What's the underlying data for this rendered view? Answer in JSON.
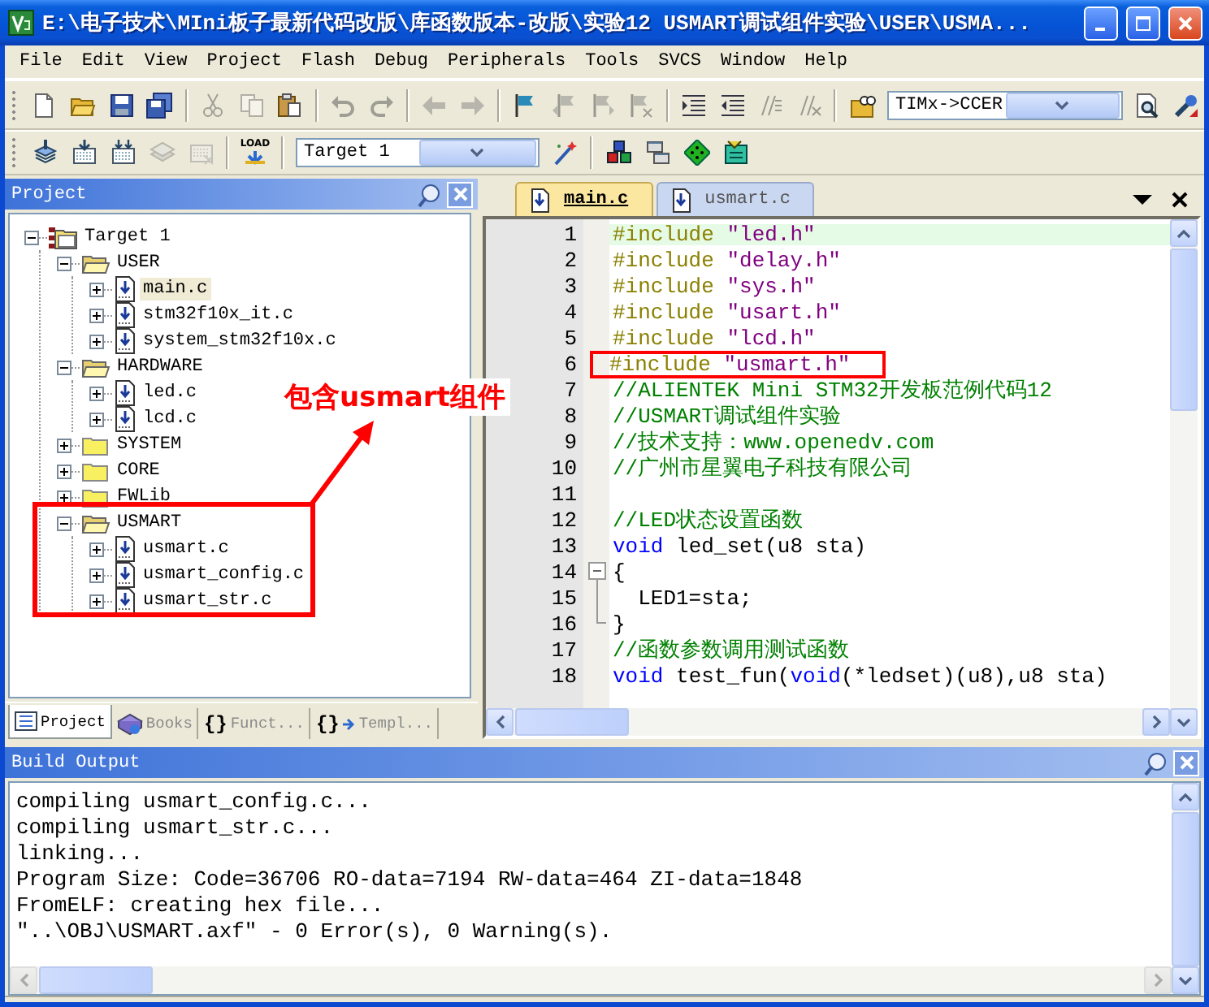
{
  "window": {
    "title": "E:\\电子技术\\MIni板子最新代码改版\\库函数版本-改版\\实验12 USMART调试组件实验\\USER\\USMA..."
  },
  "menu": [
    "File",
    "Edit",
    "View",
    "Project",
    "Flash",
    "Debug",
    "Peripherals",
    "Tools",
    "SVCS",
    "Window",
    "Help"
  ],
  "toolbar_1": [
    {
      "kind": "new",
      "disabled": false
    },
    {
      "kind": "open",
      "disabled": false
    },
    {
      "kind": "save",
      "disabled": false
    },
    {
      "kind": "save-all",
      "disabled": false
    },
    {
      "kind": "separator"
    },
    {
      "kind": "cut",
      "disabled": true
    },
    {
      "kind": "copy",
      "disabled": true
    },
    {
      "kind": "paste",
      "disabled": false
    },
    {
      "kind": "separator"
    },
    {
      "kind": "undo",
      "disabled": true
    },
    {
      "kind": "redo",
      "disabled": true
    },
    {
      "kind": "separator"
    },
    {
      "kind": "back",
      "disabled": true
    },
    {
      "kind": "forward",
      "disabled": true
    },
    {
      "kind": "separator"
    },
    {
      "kind": "bookmark",
      "disabled": false
    },
    {
      "kind": "bookmark-prev",
      "disabled": true
    },
    {
      "kind": "bookmark-next",
      "disabled": true
    },
    {
      "kind": "bookmark-clear",
      "disabled": true
    },
    {
      "kind": "separator"
    },
    {
      "kind": "indent",
      "disabled": false
    },
    {
      "kind": "unindent",
      "disabled": false
    },
    {
      "kind": "comment",
      "disabled": true
    },
    {
      "kind": "uncomment",
      "disabled": true
    },
    {
      "kind": "separator"
    },
    {
      "kind": "find-files",
      "disabled": false
    },
    {
      "kind": "combo",
      "value": "TIMx->CCER"
    },
    {
      "kind": "find",
      "disabled": false
    },
    {
      "kind": "debug",
      "disabled": false
    }
  ],
  "toolbar_2": [
    {
      "kind": "translate",
      "disabled": false
    },
    {
      "kind": "build",
      "disabled": false
    },
    {
      "kind": "rebuild",
      "disabled": false
    },
    {
      "kind": "batch",
      "disabled": true
    },
    {
      "kind": "stop",
      "disabled": true
    },
    {
      "kind": "separator"
    },
    {
      "kind": "load",
      "label": "LOAD",
      "disabled": false
    },
    {
      "kind": "separator"
    },
    {
      "kind": "combo",
      "value": "Target 1"
    },
    {
      "kind": "wand",
      "disabled": false
    },
    {
      "kind": "separator"
    },
    {
      "kind": "blocks",
      "disabled": false
    },
    {
      "kind": "windows",
      "disabled": false
    },
    {
      "kind": "diamond",
      "disabled": false
    },
    {
      "kind": "chip",
      "disabled": false
    }
  ],
  "project_panel": {
    "title": "Project",
    "tree": [
      {
        "label": "Target 1",
        "kind": "target",
        "expanded": true,
        "selected": false,
        "children": [
          {
            "label": "USER",
            "kind": "group",
            "expanded": true,
            "selected": false,
            "children": [
              {
                "label": "main.c",
                "kind": "file",
                "expanded": false,
                "selected": true
              },
              {
                "label": "stm32f10x_it.c",
                "kind": "file",
                "expanded": false,
                "selected": false
              },
              {
                "label": "system_stm32f10x.c",
                "kind": "file",
                "expanded": false,
                "selected": false
              }
            ]
          },
          {
            "label": "HARDWARE",
            "kind": "group",
            "expanded": true,
            "selected": false,
            "children": [
              {
                "label": "led.c",
                "kind": "file",
                "expanded": false,
                "selected": false
              },
              {
                "label": "lcd.c",
                "kind": "file",
                "expanded": false,
                "selected": false
              }
            ]
          },
          {
            "label": "SYSTEM",
            "kind": "group",
            "expanded": false,
            "selected": false
          },
          {
            "label": "CORE",
            "kind": "group",
            "expanded": false,
            "selected": false
          },
          {
            "label": "FWLib",
            "kind": "group",
            "expanded": false,
            "selected": false
          },
          {
            "label": "USMART",
            "kind": "group",
            "expanded": true,
            "selected": false,
            "children": [
              {
                "label": "usmart.c",
                "kind": "file",
                "expanded": false,
                "selected": false
              },
              {
                "label": "usmart_config.c",
                "kind": "file",
                "expanded": false,
                "selected": false
              },
              {
                "label": "usmart_str.c",
                "kind": "file",
                "expanded": false,
                "selected": false
              }
            ]
          }
        ]
      }
    ],
    "tabs": [
      {
        "label": "Project",
        "kind": "project",
        "selected": true
      },
      {
        "label": "Books",
        "kind": "books",
        "selected": false
      },
      {
        "label": "Funct...",
        "kind": "functions",
        "glyph": "{}",
        "selected": false
      },
      {
        "label": "Templ...",
        "kind": "templates",
        "glyph": "{}",
        "selected": false
      }
    ]
  },
  "editor": {
    "tabs": [
      {
        "label": "main.c",
        "selected": true
      },
      {
        "label": "usmart.c",
        "selected": false
      }
    ],
    "lines": [
      {
        "number": "1",
        "kind": "code",
        "current": true,
        "boxed": false,
        "segments": [
          {
            "kind": "directive",
            "text": "#include"
          },
          {
            "kind": "string",
            "text": " \"led.h\""
          }
        ]
      },
      {
        "number": "2",
        "kind": "code",
        "current": false,
        "boxed": false,
        "segments": [
          {
            "kind": "directive",
            "text": "#include"
          },
          {
            "kind": "string",
            "text": " \"delay.h\""
          }
        ]
      },
      {
        "number": "3",
        "kind": "code",
        "current": false,
        "boxed": false,
        "segments": [
          {
            "kind": "directive",
            "text": "#include"
          },
          {
            "kind": "string",
            "text": " \"sys.h\""
          }
        ]
      },
      {
        "number": "4",
        "kind": "code",
        "current": false,
        "boxed": false,
        "segments": [
          {
            "kind": "directive",
            "text": "#include"
          },
          {
            "kind": "string",
            "text": " \"usart.h\""
          }
        ]
      },
      {
        "number": "5",
        "kind": "code",
        "current": false,
        "boxed": false,
        "segments": [
          {
            "kind": "directive",
            "text": "#include"
          },
          {
            "kind": "string",
            "text": " \"lcd.h\""
          }
        ]
      },
      {
        "number": "6",
        "kind": "code",
        "current": false,
        "boxed": true,
        "segments": [
          {
            "kind": "directive",
            "text": "#include"
          },
          {
            "kind": "string",
            "text": " \"usmart.h\""
          }
        ]
      },
      {
        "number": "7",
        "kind": "code",
        "current": false,
        "boxed": false,
        "segments": [
          {
            "kind": "comment",
            "text": "//ALIENTEK Mini STM32开发板范例代码12"
          }
        ]
      },
      {
        "number": "8",
        "kind": "code",
        "current": false,
        "boxed": false,
        "segments": [
          {
            "kind": "comment",
            "text": "//USMART调试组件实验"
          }
        ]
      },
      {
        "number": "9",
        "kind": "code",
        "current": false,
        "boxed": false,
        "segments": [
          {
            "kind": "comment",
            "text": "//技术支持：www.openedv.com"
          }
        ]
      },
      {
        "number": "10",
        "kind": "code",
        "current": false,
        "boxed": false,
        "segments": [
          {
            "kind": "comment",
            "text": "//广州市星翼电子科技有限公司"
          }
        ]
      },
      {
        "number": "11",
        "kind": "code",
        "current": false,
        "boxed": false
      },
      {
        "number": "12",
        "kind": "code",
        "current": false,
        "boxed": false,
        "segments": [
          {
            "kind": "comment",
            "text": "//LED状态设置函数"
          }
        ]
      },
      {
        "number": "13",
        "kind": "code",
        "current": false,
        "boxed": false,
        "segments": [
          {
            "kind": "keyword",
            "text": "void"
          },
          {
            "kind": "plain",
            "text": " led_set(u8 sta)"
          }
        ]
      },
      {
        "number": "14",
        "kind": "fold-start",
        "current": false,
        "boxed": false,
        "segments": [
          {
            "kind": "plain",
            "text": "{"
          }
        ]
      },
      {
        "number": "15",
        "kind": "fold-body",
        "current": false,
        "boxed": false,
        "segments": [
          {
            "kind": "plain",
            "text": "  LED1=sta;"
          }
        ]
      },
      {
        "number": "16",
        "kind": "fold-end",
        "current": false,
        "boxed": false,
        "segments": [
          {
            "kind": "plain",
            "text": "}"
          }
        ]
      },
      {
        "number": "17",
        "kind": "code",
        "current": false,
        "boxed": false,
        "segments": [
          {
            "kind": "comment",
            "text": "//函数参数调用测试函数"
          }
        ]
      },
      {
        "number": "18",
        "kind": "code",
        "current": false,
        "boxed": false,
        "segments": [
          {
            "kind": "keyword",
            "text": "void"
          },
          {
            "kind": "plain",
            "text": " test_fun("
          },
          {
            "kind": "keyword",
            "text": "void"
          },
          {
            "kind": "plain",
            "text": "(*ledset)(u8),u8 sta)"
          }
        ]
      }
    ]
  },
  "build_output": {
    "title": "Build Output",
    "lines": [
      "compiling usmart_config.c...",
      "compiling usmart_str.c...",
      "linking...",
      "Program Size: Code=36706 RO-data=7194 RW-data=464 ZI-data=1848",
      "FromELF: creating hex file...",
      "\"..\\OBJ\\USMART.axf\" - 0 Error(s), 0 Warning(s)."
    ]
  },
  "annotation": {
    "label": "包含usmart组件"
  }
}
